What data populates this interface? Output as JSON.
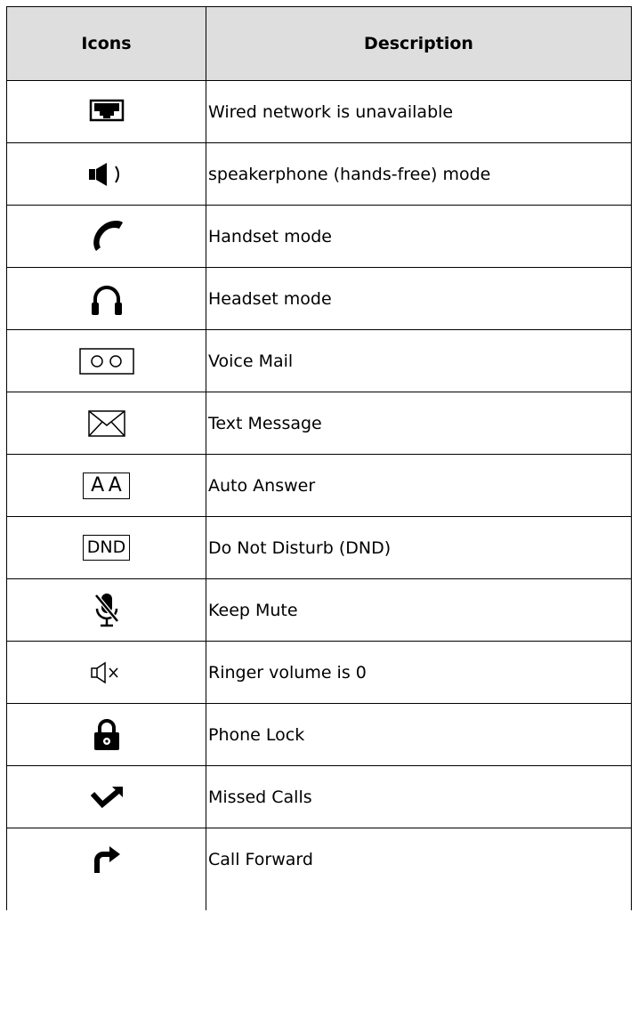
{
  "table": {
    "headers": {
      "icons": "Icons",
      "description": "Description"
    },
    "rows": [
      {
        "icon": "wired-network-unavailable-icon",
        "description": "Wired network is unavailable"
      },
      {
        "icon": "speakerphone-icon",
        "description": "speakerphone (hands-free) mode"
      },
      {
        "icon": "handset-icon",
        "description": "Handset mode"
      },
      {
        "icon": "headset-icon",
        "description": "Headset mode"
      },
      {
        "icon": "voice-mail-icon",
        "description": "Voice Mail"
      },
      {
        "icon": "text-message-icon",
        "description": "Text Message"
      },
      {
        "icon": "auto-answer-icon",
        "description": "Auto Answer",
        "icon_text": "AA"
      },
      {
        "icon": "dnd-icon",
        "description": "Do Not Disturb (DND)",
        "icon_text": "DND"
      },
      {
        "icon": "keep-mute-icon",
        "description": "Keep Mute"
      },
      {
        "icon": "ringer-volume-zero-icon",
        "description": "Ringer volume is 0"
      },
      {
        "icon": "phone-lock-icon",
        "description": "Phone Lock"
      },
      {
        "icon": "missed-calls-icon",
        "description": "Missed Calls"
      },
      {
        "icon": "call-forward-icon",
        "description": "Call Forward"
      }
    ]
  }
}
